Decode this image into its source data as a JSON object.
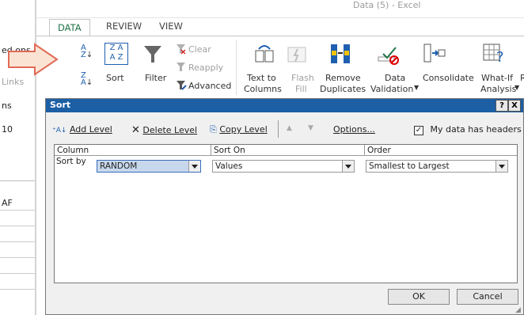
{
  "window": {
    "title": "Data (5) - Excel"
  },
  "tabs": [
    {
      "label": "DATA"
    },
    {
      "label": "REVIEW"
    },
    {
      "label": "VIEW"
    }
  ],
  "left_clip": {
    "connections": "ed  ons",
    "links": "Links",
    "ns": "ns",
    "cell_10": "10",
    "cell_af": "AF"
  },
  "ribbon": {
    "sort_label": "Sort",
    "filter_label": "Filter",
    "clear_label": "Clear",
    "reapply_label": "Reapply",
    "advanced_label": "Advanced",
    "text_to_columns_1": "Text to",
    "text_to_columns_2": "Columns",
    "flash_fill_1": "Flash",
    "flash_fill_2": "Fill",
    "remove_dup_1": "Remove",
    "remove_dup_2": "Duplicates",
    "data_validation_1": "Data",
    "data_validation_2": "Validation",
    "consolidate": "Consolidate",
    "whatif_1": "What-If",
    "whatif_2": "Analysis",
    "r_clip": "R",
    "za_letters": "Z A",
    "za_letters2": "A Z"
  },
  "dialog": {
    "title": "Sort",
    "help_button": "?",
    "close_button": "X",
    "add_level": "Add Level",
    "delete_level": "Delete Level",
    "copy_level": "Copy Level",
    "options": "Options...",
    "my_data_has_headers": "My data has headers",
    "headers_checked": true,
    "columns": {
      "column": "Column",
      "sort_on": "Sort On",
      "order": "Order"
    },
    "row": {
      "label": "Sort by",
      "column_value": "RANDOM",
      "sort_on_value": "Values",
      "order_value": "Smallest to Largest"
    },
    "ok": "OK",
    "cancel": "Cancel"
  }
}
